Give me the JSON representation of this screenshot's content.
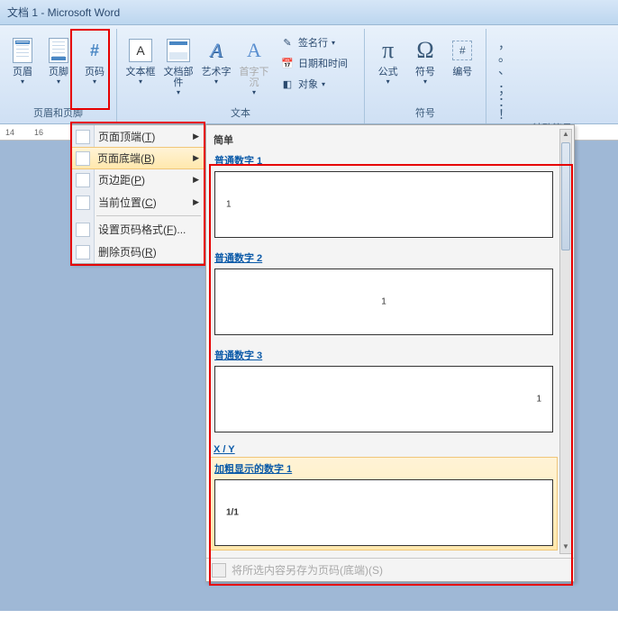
{
  "titlebar": {
    "title": "文档 1 - Microsoft Word"
  },
  "ribbon": {
    "groups": {
      "headerfooter": {
        "label": "页眉和页脚",
        "header": "页眉",
        "footer": "页脚",
        "pagenum": "页码"
      },
      "text": {
        "label": "文本",
        "textbox": "文本框",
        "parts": "文档部件",
        "wordart": "艺术字",
        "dropcap": "首字下沉",
        "signature": "签名行",
        "datetime": "日期和时间",
        "object": "对象"
      },
      "symbols": {
        "label": "符号",
        "equation": "公式",
        "symbol": "符号",
        "number": "编号"
      },
      "special": {
        "label": "特殊符号",
        "row1": "，  。 、",
        "row2": "；  ： ！"
      }
    }
  },
  "ruler": {
    "marks": [
      "14",
      "16"
    ]
  },
  "menu": {
    "items": [
      {
        "label": "页面顶端",
        "accel": "T",
        "arrow": true
      },
      {
        "label": "页面底端",
        "accel": "B",
        "arrow": true,
        "active": true
      },
      {
        "label": "页边距",
        "accel": "P",
        "arrow": true
      },
      {
        "label": "当前位置",
        "accel": "C",
        "arrow": true
      },
      {
        "label": "设置页码格式",
        "accel": "F",
        "suffix": "..."
      },
      {
        "label": "删除页码",
        "accel": "R"
      }
    ]
  },
  "gallery": {
    "section1": "简单",
    "items": [
      {
        "title": "普通数字 1",
        "sample": "1",
        "align": "left"
      },
      {
        "title": "普通数字 2",
        "sample": "1",
        "align": "center"
      },
      {
        "title": "普通数字 3",
        "sample": "1",
        "align": "right"
      }
    ],
    "section2": "X / Y",
    "items2": [
      {
        "title": "加粗显示的数字 1",
        "sample": "1/1",
        "align": "left",
        "bold": true,
        "hover": true
      }
    ],
    "footer": "将所选内容另存为页码(底端)(S)"
  }
}
